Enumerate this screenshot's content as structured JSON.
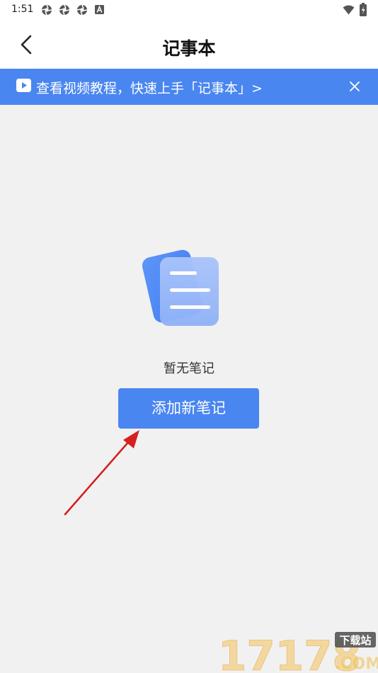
{
  "status_bar": {
    "time": "1:51",
    "notification_icons": [
      "aperture-icon",
      "aperture-icon",
      "aperture-icon",
      "a-icon"
    ],
    "right_icons": [
      "wifi-icon",
      "battery-icon"
    ]
  },
  "header": {
    "title": "记事本",
    "back_icon": "chevron-left-icon"
  },
  "banner": {
    "text": "查看视频教程，快速上手「记事本」>",
    "close_icon": "close-icon",
    "background": "#4a86f0"
  },
  "empty_state": {
    "message": "暂无笔记",
    "add_button_label": "添加新笔记",
    "illustration_icon": "document-icon"
  },
  "colors": {
    "accent": "#4a86f0",
    "page_background": "#f1f1f1",
    "annotation_arrow": "#d42020"
  },
  "watermark": {
    "brand_number": "17178",
    "tag": "下载站",
    "suffix": ".COM"
  }
}
